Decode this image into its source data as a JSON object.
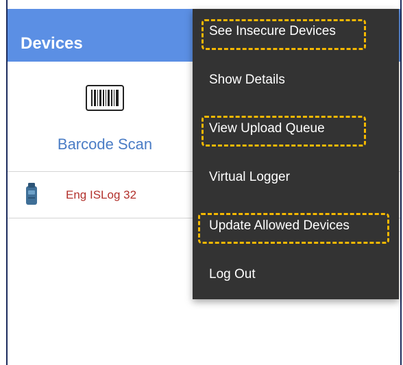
{
  "app_bar": {
    "title": "Devices",
    "color": "#5b8fe4"
  },
  "barcode_scan": {
    "icon": "barcode-icon",
    "label": "Barcode Scan"
  },
  "device_list": [
    {
      "icon": "logger-device-icon",
      "name": "Eng ISLog 32",
      "name_color": "#b2302b"
    }
  ],
  "overflow_menu": {
    "background": "#333333",
    "items": [
      {
        "label": "See Insecure Devices",
        "highlighted": true
      },
      {
        "label": "Show Details",
        "highlighted": false
      },
      {
        "label": "View Upload Queue",
        "highlighted": true
      },
      {
        "label": "Virtual Logger",
        "highlighted": false
      },
      {
        "label": "Update Allowed Devices",
        "highlighted": true
      },
      {
        "label": "Log Out",
        "highlighted": false
      }
    ]
  },
  "annotation": {
    "highlight_color": "#f5b800",
    "style": "dashed"
  }
}
